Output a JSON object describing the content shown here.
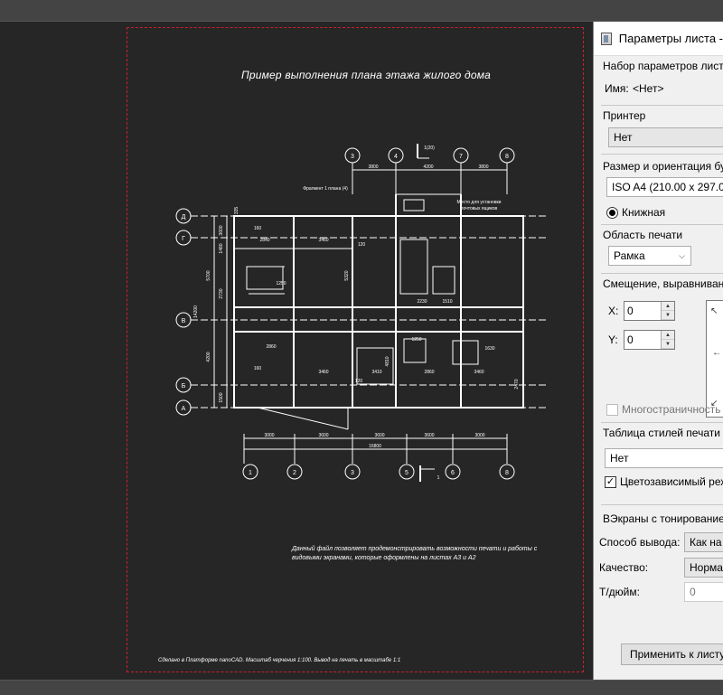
{
  "drawing": {
    "title": "Пример выполнения плана этажа жилого дома",
    "fragment_label": "Фрагмент 1 плана (4)",
    "elevator_label_1": "Место для установки",
    "elevator_label_2": "почтовых ящиков",
    "section_mark": "1(20)",
    "section_mark_bottom": "1",
    "note": "Данный файл позволяет продемонстрировать возможности печати и работы с видовыми экранами, которые оформлены на листах А3 и А2",
    "footer": "Сделано в Платформе nanoCAD. Масштаб черчения 1:100. Вывод на печать в масштабе 1:1",
    "axes_top": [
      "3",
      "4",
      "7",
      "8"
    ],
    "axes_bottom": [
      "1",
      "2",
      "3",
      "5",
      "6",
      "8"
    ],
    "axes_left": [
      "Д",
      "Г",
      "В",
      "Б",
      "А"
    ],
    "dims_top": [
      "3800",
      "4200",
      "3800"
    ],
    "dims_bottom": [
      "3000",
      "3600",
      "3600",
      "3600",
      "3000"
    ],
    "dim_total": "16800",
    "room_dims": [
      "2840",
      "3460",
      "160",
      "120",
      "2230",
      "1510",
      "1250",
      "2860",
      "3460",
      "1630",
      "1250",
      "120",
      "160",
      "3460",
      "2860",
      "3410",
      "5700",
      "4200",
      "2730",
      "1480",
      "2470",
      "5320",
      "1500",
      "4810",
      "14200",
      "335",
      "3600"
    ]
  },
  "dialog": {
    "title": "Параметры листа -",
    "preset_label": "Набор параметров лист",
    "name_label": "Имя:",
    "name_value": "<Нет>",
    "printer_section": "Принтер",
    "printer_value": "Нет",
    "paper_section": "Размер и ориентация бу",
    "paper_value": "ISO A4 (210.00 x 297.00 M",
    "orientation_value": "Книжная",
    "plot_area_section": "Область печати",
    "plot_area_value": "Рамка",
    "offset_section": "Смещение, выравнивани",
    "x_label": "X:",
    "x_value": "0",
    "y_label": "Y:",
    "y_value": "0",
    "multipage_label": "Многостраничность",
    "style_table_section": "Таблица стилей печати",
    "style_table_value": "Нет",
    "color_dependent_label": "Цветозависимый реж",
    "shaded_viewports_section": "ВЭкраны с тонирование",
    "output_method_label": "Способ вывода:",
    "output_method_value": "Как на",
    "quality_label": "Качество:",
    "quality_value": "Норма",
    "dpi_label": "Т/дюйм:",
    "dpi_value": "0",
    "apply_button": "Применить к листу"
  },
  "icons": [
    "app-window-icon",
    "dropdown-arrow-icon",
    "spin-up-icon",
    "spin-down-icon",
    "radio-checked-icon",
    "checkbox-checked-icon",
    "checkbox-unchecked-icon"
  ]
}
